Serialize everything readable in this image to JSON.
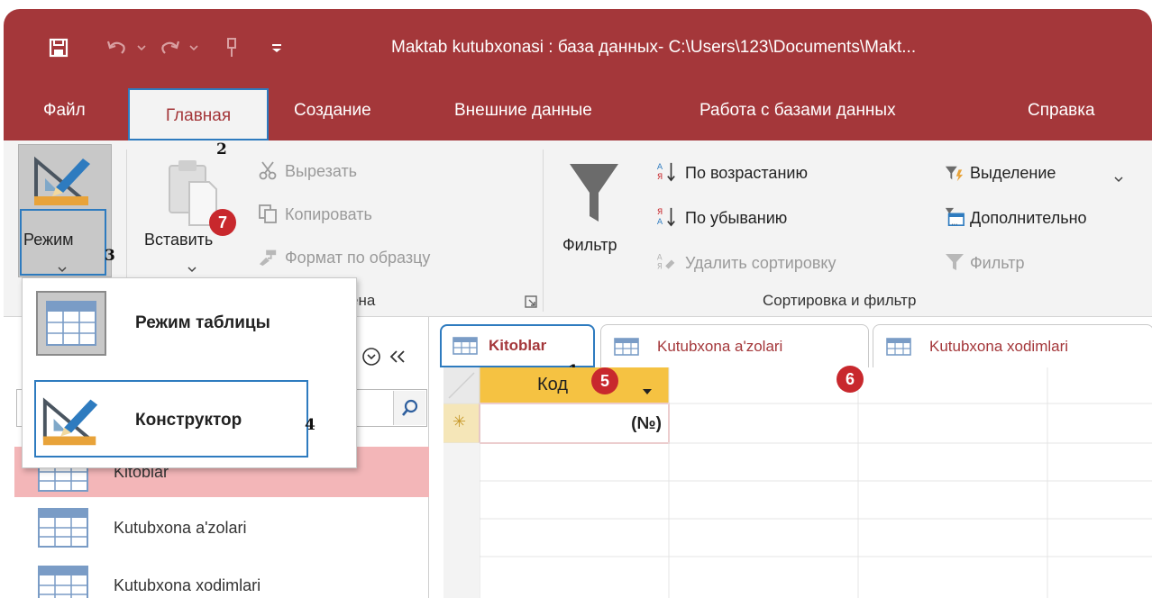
{
  "window": {
    "title": "Maktab kutubxonasi : база данных- C:\\Users\\123\\Documents\\Makt..."
  },
  "ribbon_tabs": [
    "Файл",
    "Главная",
    "Создание",
    "Внешние данные",
    "Работа с базами данных",
    "Справка"
  ],
  "ribbon": {
    "mode_label": "Режим",
    "paste_label": "Вставить",
    "cut_label": "Вырезать",
    "copy_label": "Копировать",
    "format_painter_label": "Формат по образцу",
    "clipboard_group_fragment": "ена",
    "filter_label": "Фильтр",
    "sort_asc_label": "По возрастанию",
    "sort_desc_label": "По убыванию",
    "remove_sort_label": "Удалить сортировку",
    "selection_label": "Выделение",
    "advanced_label": "Дополнительно",
    "toggle_filter_label": "Фильтр",
    "sort_filter_group": "Сортировка и фильтр"
  },
  "mode_menu": {
    "items": [
      {
        "label": "Режим таблицы",
        "icon": "datasheet-view-icon"
      },
      {
        "label": "Конструктор",
        "icon": "design-view-icon"
      }
    ]
  },
  "nav_pane": {
    "items": [
      "Kitoblar",
      "Kutubxona a'zolari",
      "Kutubxona xodimlari"
    ]
  },
  "doc_tabs": [
    "Kitoblar",
    "Kutubxona a'zolari",
    "Kutubxona xodimlari"
  ],
  "grid": {
    "column_header": "Код",
    "new_row_marker": "✳",
    "new_row_value": "(№)"
  },
  "annotations": {
    "numbers": [
      "1",
      "2",
      "3",
      "4"
    ],
    "badges": [
      "5",
      "6",
      "7"
    ]
  },
  "colors": {
    "accent": "#a4373a",
    "highlight_box": "#2e7bbf",
    "badge": "#c8282d",
    "column_header_bg": "#f5c242",
    "selected_nav_bg": "#f3b6b8"
  }
}
